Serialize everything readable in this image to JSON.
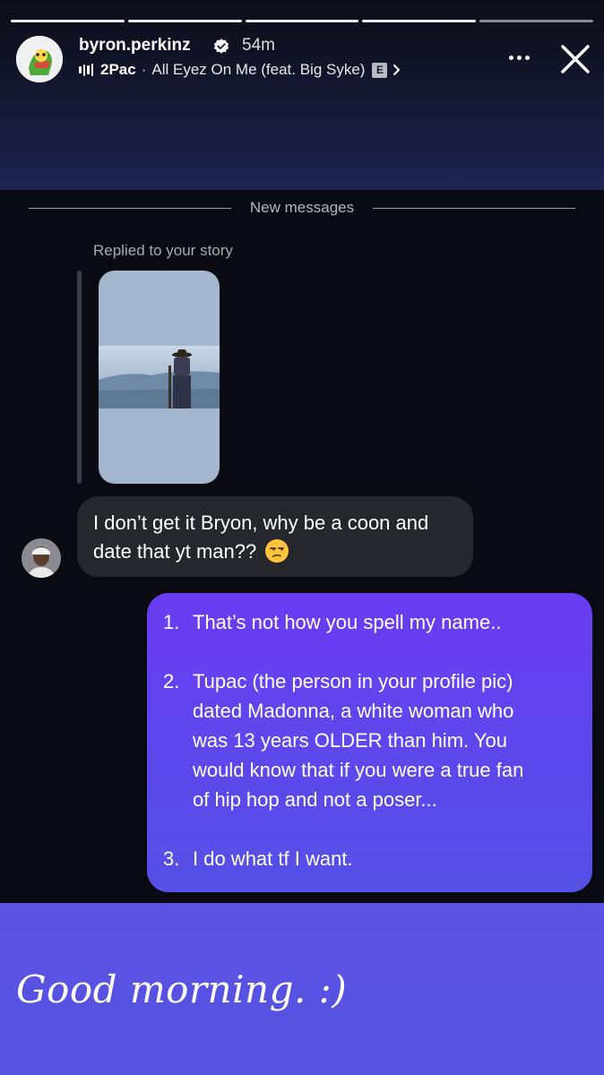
{
  "header": {
    "username": "byron.perkinz",
    "time": "54m",
    "song": {
      "artist": "2Pac",
      "separator": "·",
      "title": "All Eyez On Me (feat. Big Syke)",
      "explicit": "E"
    },
    "icons": [
      "verified-badge-icon",
      "audio-bars-icon",
      "chevron-right-icon",
      "more-icon",
      "close-icon"
    ],
    "progress_segments": 5,
    "active_segment": 5
  },
  "chat": {
    "divider_label": "New messages",
    "replied_label": "Replied to your story",
    "incoming": {
      "line1": "I don’t get it Bryon, why be a coon and",
      "line2": "date that yt man??",
      "emoji": "unamused-face"
    },
    "outgoing": {
      "item1_num": "1.",
      "item1_text": "That’s not how you spell my name..",
      "item2_num": "2.",
      "item2_line1": "Tupac (the person in your profile pic)",
      "item2_line2": "dated Madonna, a white woman who",
      "item2_line3": "was 13 years OLDER than him. You",
      "item2_line4": "would know that if you were a true fan",
      "item2_line5": "of hip hop and not a poser...",
      "item3_num": "3.",
      "item3_text": "I do what tf I want."
    }
  },
  "caption": {
    "text": "Good morning. :)"
  },
  "colors": {
    "background": "#0a0b12",
    "incoming_bubble": "#26272d",
    "outgoing_bubble_top": "#6a3cf2",
    "outgoing_bubble_bottom": "#5550e6",
    "caption_band": "#5653e0"
  }
}
